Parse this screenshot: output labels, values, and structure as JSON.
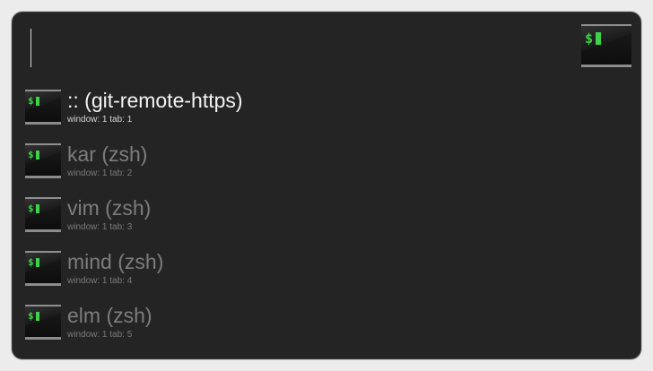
{
  "search": {
    "value": "",
    "placeholder": ""
  },
  "app_icon": "terminal-icon",
  "colors": {
    "background": "#242424",
    "title_selected": "#f2f2f2",
    "title_normal": "#7d7d7d",
    "prompt_green": "#3fd14a"
  },
  "results": [
    {
      "title": ":: (git-remote-https)",
      "subtitle": "window: 1 tab: 1",
      "selected": true,
      "icon": "terminal-icon"
    },
    {
      "title": "kar (zsh)",
      "subtitle": "window: 1 tab: 2",
      "selected": false,
      "icon": "terminal-icon"
    },
    {
      "title": "vim (zsh)",
      "subtitle": "window: 1 tab: 3",
      "selected": false,
      "icon": "terminal-icon"
    },
    {
      "title": "mind (zsh)",
      "subtitle": "window: 1 tab: 4",
      "selected": false,
      "icon": "terminal-icon"
    },
    {
      "title": "elm (zsh)",
      "subtitle": "window: 1 tab: 5",
      "selected": false,
      "icon": "terminal-icon"
    }
  ]
}
